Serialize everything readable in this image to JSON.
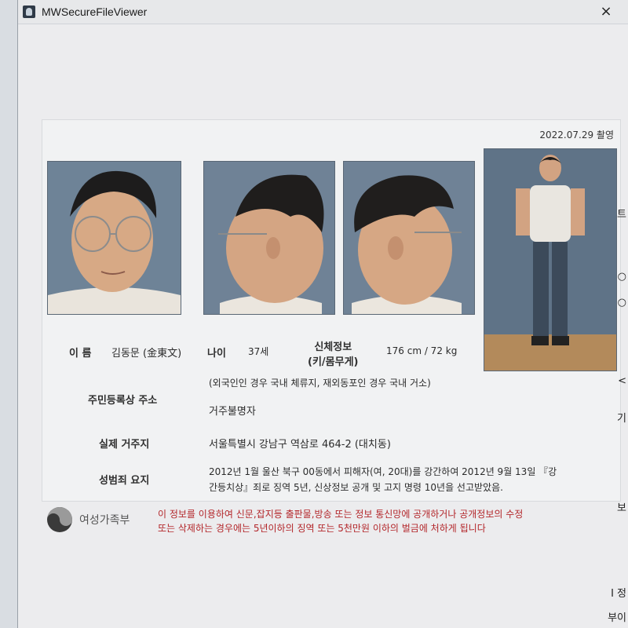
{
  "window": {
    "title": "MWSecureFileViewer",
    "close_glyph": "×"
  },
  "doc": {
    "date": "2022.07.29 촬영",
    "name_label": "이 름",
    "name_value": "김동문 (金東文)",
    "age_label": "나이",
    "age_value": "37세",
    "body_label_1": "신체정보",
    "body_label_2": "(키/몸무게)",
    "body_value": "176 cm /  72 kg",
    "reg_addr_label": "주민등록상 주소",
    "reg_addr_note": "(외국인인 경우 국내 체류지, 재외동포인 경우 국내 거소)",
    "reg_addr_value": "거주불명자",
    "actual_addr_label": "실제 거주지",
    "actual_addr_value": "서울특별시 강남구 역삼로 464-2 (대치동)",
    "crime_label": "성범죄 요지",
    "crime_line1": "2012년 1월 울산 북구 00동에서 피해자(여, 20대)를 강간하여 2012년 9월 13일 『강",
    "crime_line2": "간등치상』죄로 징역 5년, 신상정보 공개 및 고지 명령 10년을 선고받았음."
  },
  "footer": {
    "logo_text": "여성가족부",
    "warning_line1": "이 정보를 이용하여 신문,잡지등 출판물,방송 또는 정보 통신망에 공개하거나 공개정보의 수정",
    "warning_line2": "또는 삭제하는 경우에는 5년이하의 징역 또는 5천만원 이하의 벌금에 처하게 됩니다"
  },
  "side": {
    "frag1": "트",
    "frag2": "○",
    "frag3": "○",
    "frag4": "<",
    "frag5": "기",
    "frag6": "보",
    "frag7": "I 정",
    "frag8": "부이"
  },
  "icons": {
    "app": "app-icon",
    "close": "close-icon",
    "logo": "taegeuk-logo-icon"
  }
}
